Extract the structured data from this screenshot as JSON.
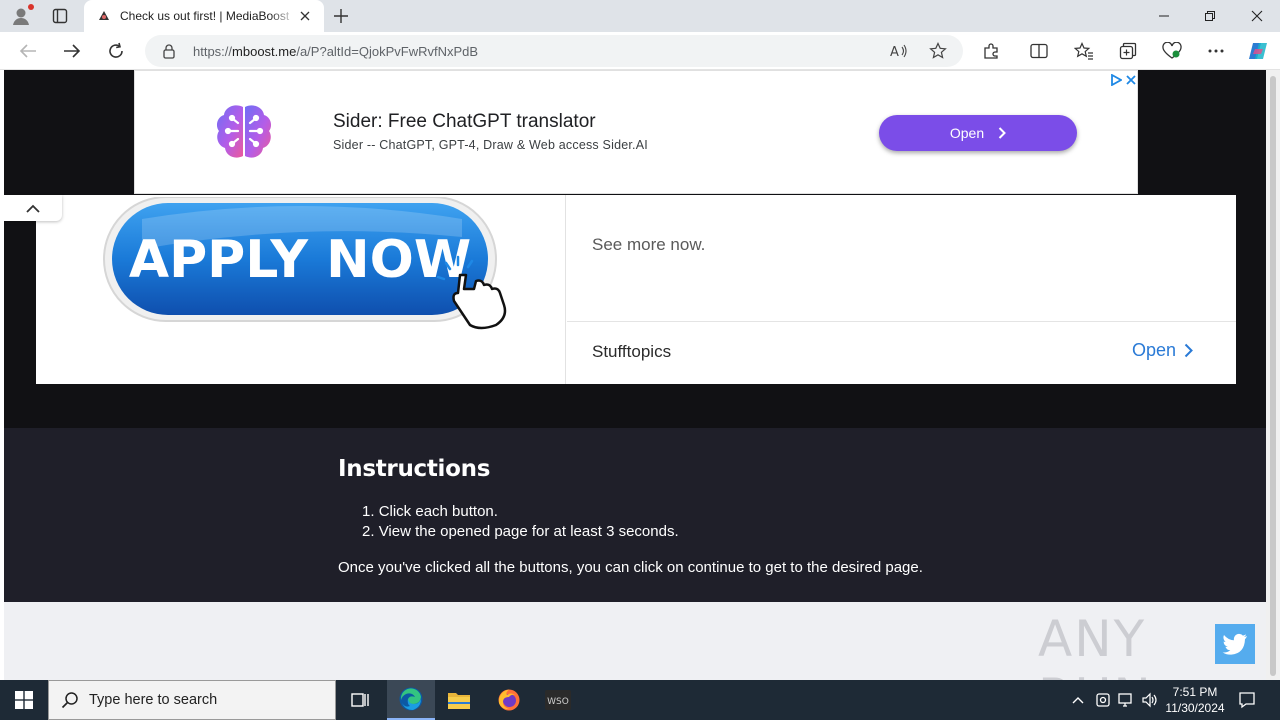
{
  "browser": {
    "tab_title": "Check us out first! | MediaBoost",
    "url_prefix": "https://",
    "url_host": "mboost.me",
    "url_path": "/a/P?altId=QjokPvFwRvfNxPdB"
  },
  "ad": {
    "title": "Sider: Free ChatGPT translator",
    "subtitle": "Sider -- ChatGPT, GPT-4, Draw & Web access Sider.AI",
    "button": "Open"
  },
  "card": {
    "apply_text": "APPLY NOW",
    "see_more": "See more now.",
    "site": "Stufftopics",
    "open": "Open"
  },
  "instructions": {
    "title": "Instructions",
    "steps": [
      "Click each button.",
      "View the opened page for at least 3 seconds."
    ],
    "note": "Once you've clicked all the buttons, you can click on continue to get to the desired page."
  },
  "watermark": "ANY RUN",
  "taskbar": {
    "search_placeholder": "Type here to search",
    "time": "7:51 PM",
    "date": "11/30/2024"
  },
  "colors": {
    "ad_button": "#7b4de8",
    "link_blue": "#2a7ad6",
    "page_dark": "#111114",
    "instructions_bg": "#1f1f29",
    "twitter": "#55acee"
  }
}
